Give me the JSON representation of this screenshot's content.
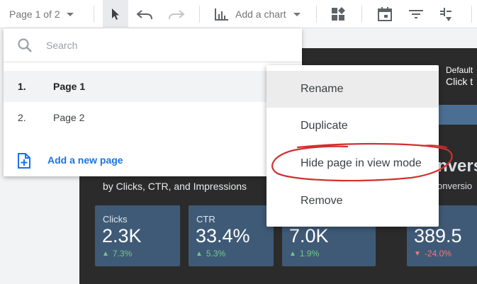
{
  "toolbar": {
    "page_selector": "Page 1 of 2",
    "add_chart_label": "Add a chart"
  },
  "page_menu": {
    "search_placeholder": "Search",
    "pages": [
      {
        "number": "1.",
        "name": "Page 1",
        "active": true
      },
      {
        "number": "2.",
        "name": "Page 2",
        "active": false
      }
    ],
    "add_page_label": "Add a new page"
  },
  "context_menu": {
    "items": [
      "Rename",
      "Duplicate",
      "Hide page in view mode",
      "Remove"
    ]
  },
  "report": {
    "right_info_line1": "Default",
    "right_info_line2": "Click t",
    "subtitle": "by Clicks, CTR, and Impressions",
    "conversions_title": "nvers",
    "conversions_subtitle": "onversio",
    "kpis": [
      {
        "label": "Clicks",
        "value": "2.3K",
        "change": "7.3%",
        "direction": "up"
      },
      {
        "label": "CTR",
        "value": "33.4%",
        "change": "5.3%",
        "direction": "up"
      },
      {
        "label": "",
        "value": "7.0K",
        "change": "1.9%",
        "direction": "up"
      },
      {
        "label": "ersions",
        "value": "389.5",
        "change": "-24.0%",
        "direction": "down"
      }
    ]
  },
  "colors": {
    "accent_blue": "#1a73e8",
    "kpi_card": "#3f5a76",
    "positive": "#74c98a",
    "negative": "#f07a7a",
    "annotation": "#d32f2f"
  }
}
